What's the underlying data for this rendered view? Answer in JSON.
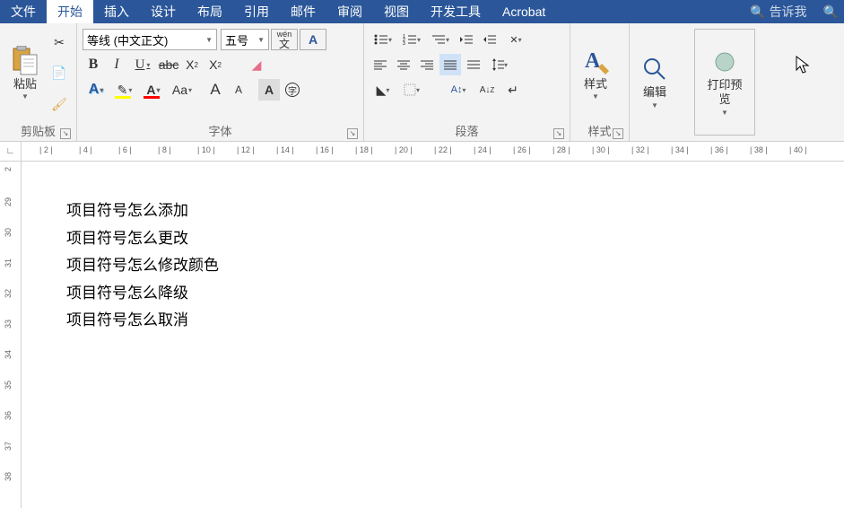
{
  "menubar": {
    "tabs": [
      "文件",
      "开始",
      "插入",
      "设计",
      "布局",
      "引用",
      "邮件",
      "审阅",
      "视图",
      "开发工具",
      "Acrobat"
    ],
    "active_index": 1,
    "search_placeholder": "告诉我"
  },
  "ribbon": {
    "clipboard": {
      "paste_label": "粘贴",
      "group_label": "剪贴板"
    },
    "font": {
      "font_name": "等线 (中文正文)",
      "font_size": "五号",
      "pinyin_label": "wén",
      "group_label": "字体",
      "bold": "B",
      "italic": "I",
      "underline": "U",
      "increase": "A",
      "decrease": "A"
    },
    "paragraph": {
      "group_label": "段落"
    },
    "styles": {
      "btn_label": "样式",
      "group_label": "样式"
    },
    "editing": {
      "btn_label": "编辑"
    },
    "printpreview": {
      "btn_label": "打印预览"
    }
  },
  "hruler_ticks": [
    "2",
    "4",
    "6",
    "8",
    "10",
    "12",
    "14",
    "16",
    "18",
    "20",
    "22",
    "24",
    "26",
    "28",
    "30",
    "32",
    "34",
    "36",
    "38",
    "40"
  ],
  "vruler_ticks": [
    "2",
    "29",
    "30",
    "31",
    "32",
    "33",
    "34",
    "35",
    "36",
    "37",
    "38"
  ],
  "document": {
    "lines": [
      "项目符号怎么添加",
      "项目符号怎么更改",
      "项目符号怎么修改颜色",
      "项目符号怎么降级",
      "项目符号怎么取消"
    ]
  }
}
